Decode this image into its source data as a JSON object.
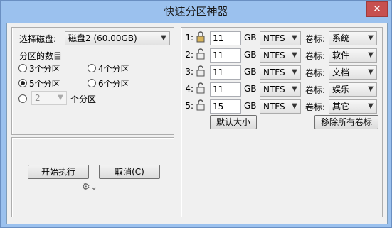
{
  "window": {
    "title": "快速分区神器",
    "close": "✕"
  },
  "left": {
    "disk_label": "选择磁盘:",
    "disk_value": "磁盘2 (60.00GB)",
    "count_label": "分区的数目",
    "options": [
      "3个分区",
      "4个分区",
      "5个分区",
      "6个分区"
    ],
    "selected_option": "5个分区",
    "custom_value": "2",
    "custom_suffix": "个分区",
    "start_button": "开始执行",
    "cancel_button": "取消(C)",
    "expand_icon": "gear-expand-icon"
  },
  "right": {
    "unit": "GB",
    "vol_label": "卷标:",
    "rows": [
      {
        "index": "1:",
        "locked": true,
        "size": "11",
        "fs": "NTFS",
        "volume": "系统"
      },
      {
        "index": "2:",
        "locked": false,
        "size": "11",
        "fs": "NTFS",
        "volume": "软件"
      },
      {
        "index": "3:",
        "locked": false,
        "size": "11",
        "fs": "NTFS",
        "volume": "文档"
      },
      {
        "index": "4:",
        "locked": false,
        "size": "11",
        "fs": "NTFS",
        "volume": "娱乐"
      },
      {
        "index": "5:",
        "locked": false,
        "size": "15",
        "fs": "NTFS",
        "volume": "其它"
      }
    ],
    "default_size_button": "默认大小",
    "remove_labels_button": "移除所有卷标"
  },
  "colors": {
    "titlebar": "#9bc1ee",
    "close": "#c75050",
    "client": "#f0f0f0"
  }
}
